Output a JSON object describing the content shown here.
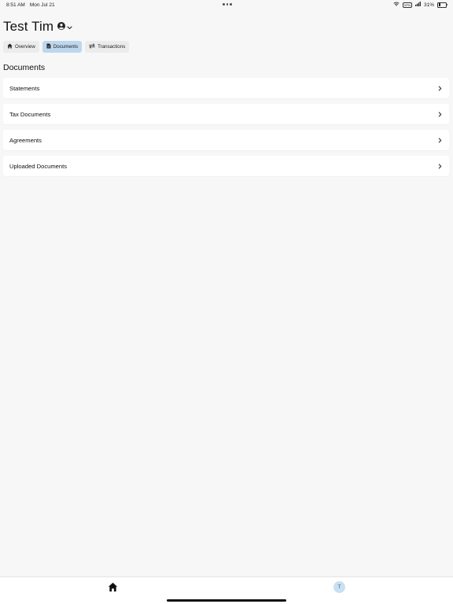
{
  "status_bar": {
    "time": "8:51 AM",
    "date": "Mon Jul 21",
    "vpn": "VPN",
    "battery_text": "31%",
    "battery_level": 0.31
  },
  "header": {
    "title": "Test Tim",
    "account_icon": "user-circle-icon",
    "chevron_icon": "chevron-down-icon"
  },
  "tabs": [
    {
      "label": "Overview",
      "icon": "home-icon",
      "active": false
    },
    {
      "label": "Documents",
      "icon": "document-icon",
      "active": true
    },
    {
      "label": "Transactions",
      "icon": "swap-arrows-icon",
      "active": false
    }
  ],
  "section": {
    "title": "Documents",
    "items": [
      {
        "label": "Statements"
      },
      {
        "label": "Tax Documents"
      },
      {
        "label": "Agreements"
      },
      {
        "label": "Uploaded Documents"
      }
    ]
  },
  "bottom_bar": {
    "home_icon": "home-icon",
    "avatar_initial": "T"
  },
  "colors": {
    "active_tab": "#bcd7ee",
    "tab_bg": "#ececec",
    "avatar_bg": "#c9dff2",
    "page_bg": "#f7f7f7"
  }
}
